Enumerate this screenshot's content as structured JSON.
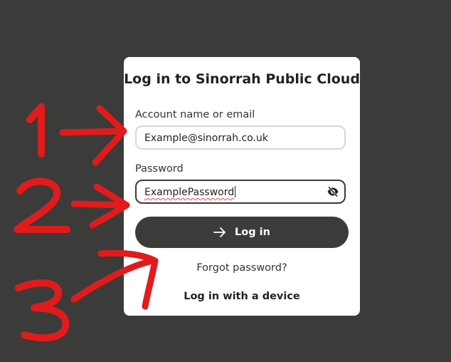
{
  "login": {
    "title": "Log in to Sinorrah Public Cloud",
    "account_label": "Account name or email",
    "account_value": "Example@sinorrah.co.uk",
    "password_label": "Password",
    "password_value": "ExamplePassword",
    "login_button": "Log in",
    "forgot_link": "Forgot password?",
    "device_link": "Log in with a device"
  },
  "icons": {
    "login_arrow": "arrow-right-icon",
    "password_toggle": "eye-slash-icon"
  },
  "colors": {
    "background": "#3b3b3a",
    "card": "#ffffff",
    "button": "#3b3b3a",
    "annotation": "#e01b1b"
  }
}
